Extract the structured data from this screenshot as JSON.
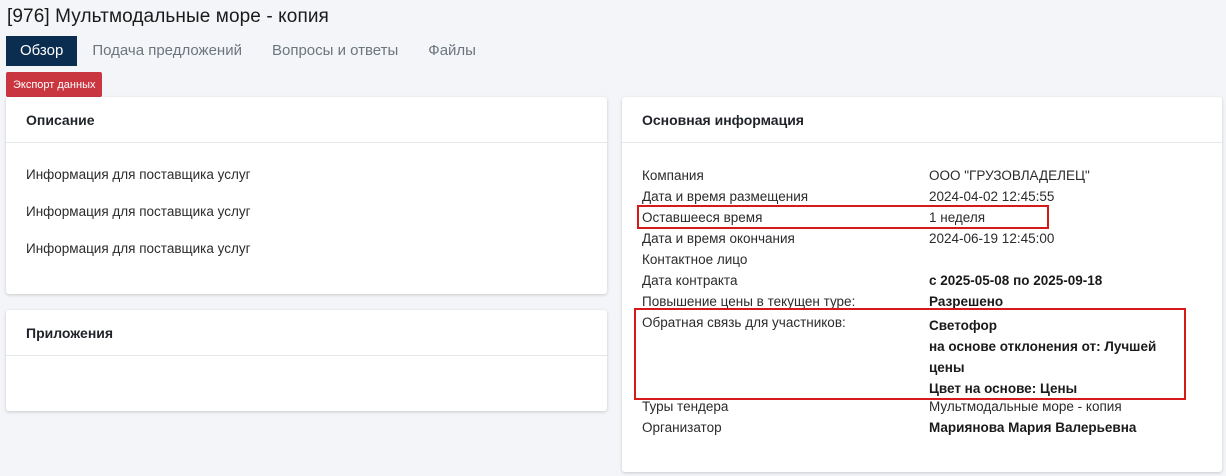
{
  "page": {
    "title": "[976] Мультмодальные море - копия"
  },
  "tabs": [
    {
      "label": "Обзор",
      "active": true
    },
    {
      "label": "Подача предложений",
      "active": false
    },
    {
      "label": "Вопросы и ответы",
      "active": false
    },
    {
      "label": "Файлы",
      "active": false
    }
  ],
  "toolbar": {
    "export_label": "Экспорт данных"
  },
  "description": {
    "title": "Описание",
    "lines": [
      "Информация для поставщика услуг",
      "Информация для поставщика услуг",
      "Информация для поставщика услуг"
    ]
  },
  "attachments": {
    "title": "Приложения"
  },
  "info": {
    "title": "Основная информация",
    "rows": [
      {
        "label": "Компания",
        "value": "ООО \"ГРУЗОВЛАДЕЛЕЦ\""
      },
      {
        "label": "Дата и время размещения",
        "value": "2024-04-02 12:45:55"
      },
      {
        "label": "Оставшееся время",
        "value": "1 неделя"
      },
      {
        "label": "Дата и время окончания",
        "value": "2024-06-19 12:45:00"
      },
      {
        "label": "Контактное лицо",
        "value": ""
      },
      {
        "label": "Дата контракта",
        "value": "с 2025-05-08 по 2025-09-18"
      },
      {
        "label": "Повышение цены в текущен туре:",
        "value": "Разрешено"
      }
    ],
    "feedback": {
      "label": "Обратная связь для участников:",
      "lines": [
        "Светофор",
        "на основе отклонения от: Лучшей",
        "цены",
        "Цвет на основе: Цены"
      ]
    },
    "rows_after": [
      {
        "label": "Туры тендера",
        "value": "Мультмодальные море - копия"
      },
      {
        "label": "Организатор",
        "value": "Мариянова Мария Валерьевна"
      }
    ]
  },
  "colors": {
    "active_tab": "#0b2d4f",
    "export_button": "#c9363f",
    "highlight": "#d61a1a"
  }
}
